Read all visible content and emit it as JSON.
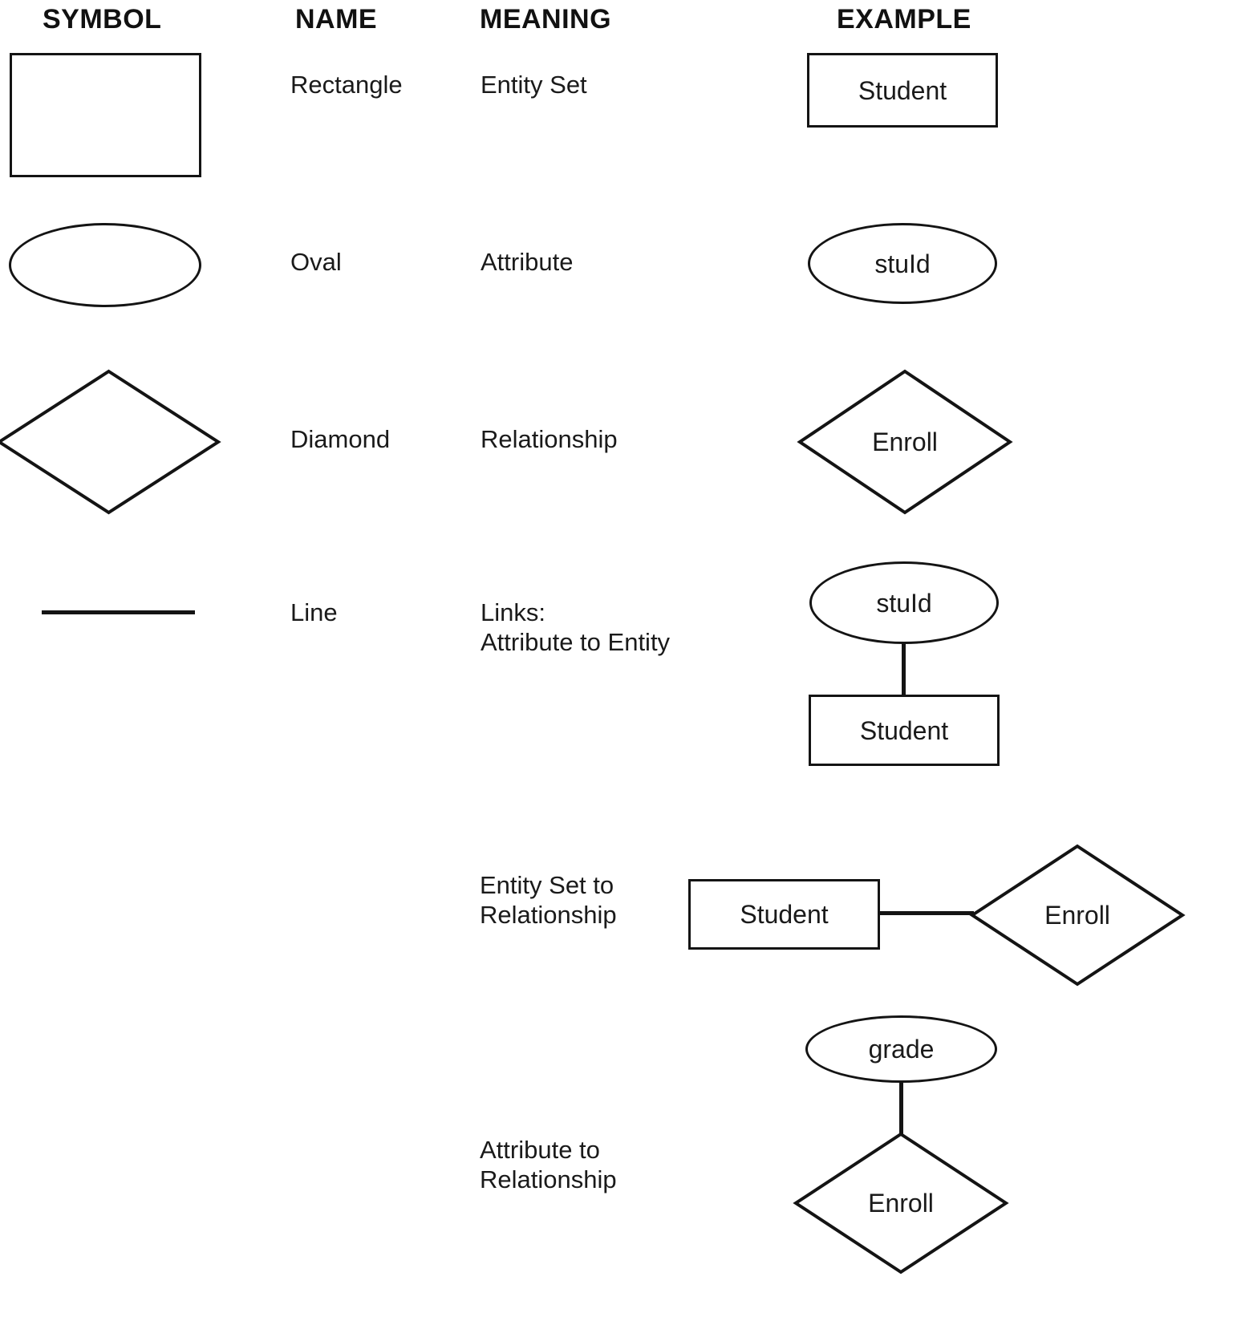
{
  "headers": {
    "symbol": "SYMBOL",
    "name": "NAME",
    "meaning": "MEANING",
    "example": "EXAMPLE"
  },
  "rows": [
    {
      "name": "Rectangle",
      "meaning": "Entity Set",
      "symbol_shape": "rectangle",
      "example_labels": [
        "Student"
      ]
    },
    {
      "name": "Oval",
      "meaning": "Attribute",
      "symbol_shape": "oval",
      "example_labels": [
        "stuId"
      ]
    },
    {
      "name": "Diamond",
      "meaning": "Relationship",
      "symbol_shape": "diamond",
      "example_labels": [
        "Enroll"
      ]
    },
    {
      "name": "Line",
      "meaning": "Links:\nAttribute to Entity",
      "symbol_shape": "line",
      "example_labels": [
        "stuId",
        "Student"
      ]
    },
    {
      "name": "",
      "meaning": "Entity Set to\nRelationship",
      "symbol_shape": "none",
      "example_labels": [
        "Student",
        "Enroll"
      ]
    },
    {
      "name": "",
      "meaning": "Attribute to\nRelationship",
      "symbol_shape": "none",
      "example_labels": [
        "grade",
        "Enroll"
      ]
    }
  ],
  "examples": {
    "student_entity_1": "Student",
    "stuid_attribute_1": "stuId",
    "enroll_relationship_1": "Enroll",
    "stuid_attribute_2": "stuId",
    "student_entity_2": "Student",
    "student_entity_3": "Student",
    "enroll_relationship_2": "Enroll",
    "grade_attribute": "grade",
    "enroll_relationship_3": "Enroll"
  },
  "colors": {
    "stroke": "#141414",
    "text": "#1a1a1a",
    "background": "#ffffff"
  }
}
